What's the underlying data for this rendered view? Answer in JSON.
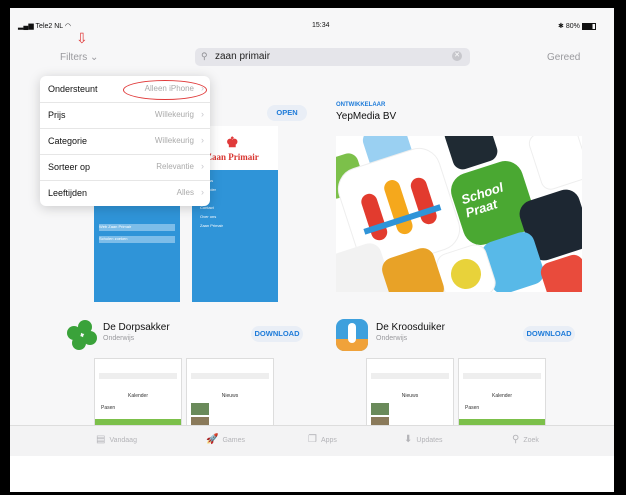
{
  "status_bar": {
    "carrier": "Tele2 NL",
    "time": "15:34",
    "battery": "80%"
  },
  "nav": {
    "filters_label": "Filters",
    "cancel_label": "Gereed",
    "arrow_glyph": "⇩"
  },
  "search": {
    "query": "zaan primair"
  },
  "filters": {
    "rows": [
      {
        "label": "Ondersteunt",
        "value": "Alleen iPhone"
      },
      {
        "label": "Prijs",
        "value": "Willekeurig"
      },
      {
        "label": "Categorie",
        "value": "Willekeurig"
      },
      {
        "label": "Sorteer op",
        "value": "Relevantie"
      },
      {
        "label": "Leeftijden",
        "value": "Alles"
      }
    ]
  },
  "zaan_card": {
    "button": "OPEN",
    "logo_text": "Zaan Primair",
    "menu_items": [
      "Nieuws",
      "Kalender",
      "Info",
      "Contact",
      "Over ons",
      "Zaan Primair"
    ],
    "left_items": [
      "Web Zaan Primair",
      "Scholen zoeken"
    ]
  },
  "developer": {
    "caption": "ONTWIKKELAAR",
    "name": "YepMedia BV",
    "badge_text": "School Praat"
  },
  "apps": [
    {
      "name": "De Dorpsakker",
      "category": "Onderwijs",
      "button": "DOWNLOAD"
    },
    {
      "name": "De Kroosduiker",
      "category": "Onderwijs",
      "button": "DOWNLOAD"
    }
  ],
  "preview": {
    "titles": [
      "Kalender",
      "Nieuws",
      "Nieuws",
      "Kalender"
    ],
    "sub": "Pasen"
  },
  "tabbar": {
    "items": [
      {
        "label": "Vandaag",
        "icon": "today-icon"
      },
      {
        "label": "Games",
        "icon": "games-icon"
      },
      {
        "label": "Apps",
        "icon": "apps-icon"
      },
      {
        "label": "Updates",
        "icon": "updates-icon"
      },
      {
        "label": "Zoek",
        "icon": "search-icon"
      }
    ]
  },
  "colors": {
    "accent": "#1e7bd9",
    "annotation": "#e03a3a",
    "app_blue": "#2f94d8"
  }
}
